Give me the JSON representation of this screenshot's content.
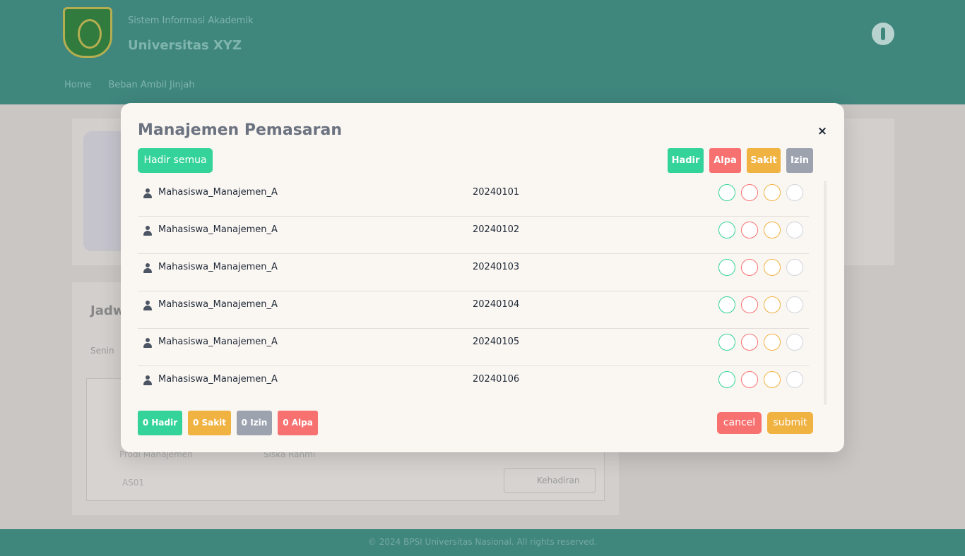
{
  "header": {
    "subtitle": "Sistem Informasi Akademik",
    "title": "Universitas XYZ",
    "nav": [
      "Home",
      "Beban Ambil Jinjah"
    ]
  },
  "background": {
    "card_heading": "Jadw",
    "card_sub": "Senin",
    "inner_item_1": "Prodi Manajemen",
    "inner_item_2": "AS01",
    "inner_item_3": "Siska Rahmi",
    "kehadiran_button": "Kehadiran"
  },
  "footer": {
    "text": "© 2024 BPSI Universitas Nasional. All rights reserved."
  },
  "modal": {
    "title": "Manajemen Pemasaran",
    "close_label": "×",
    "hadir_all_label": "Hadir semua",
    "legend": {
      "hadir": "Hadir",
      "alpa": "Alpa",
      "sakit": "Sakit",
      "izin": "Izin"
    },
    "students": [
      {
        "name": "Mahasiswa_Manajemen_A",
        "nim": "20240101"
      },
      {
        "name": "Mahasiswa_Manajemen_A",
        "nim": "20240102"
      },
      {
        "name": "Mahasiswa_Manajemen_A",
        "nim": "20240103"
      },
      {
        "name": "Mahasiswa_Manajemen_A",
        "nim": "20240104"
      },
      {
        "name": "Mahasiswa_Manajemen_A",
        "nim": "20240105"
      },
      {
        "name": "Mahasiswa_Manajemen_A",
        "nim": "20240106"
      }
    ],
    "counts": {
      "hadir": "0 Hadir",
      "sakit": "0 Sakit",
      "izin": "0 Izin",
      "alpa": "0 Alpa"
    },
    "cancel_label": "cancel",
    "submit_label": "submit"
  },
  "colors": {
    "teal_header": "#3f867d",
    "hadir": "#34d399",
    "alpa": "#f87171",
    "sakit": "#f0b241",
    "izin": "#9ca3af"
  }
}
